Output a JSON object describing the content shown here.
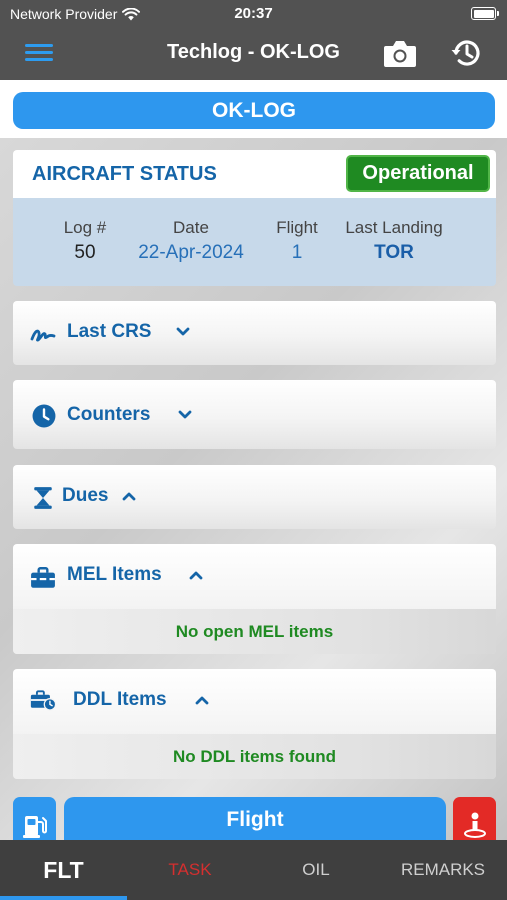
{
  "status_bar": {
    "carrier": "Network Provider",
    "time": "20:37"
  },
  "nav": {
    "title": "Techlog - OK-LOG",
    "icons": [
      "menu-icon",
      "camera-icon",
      "history-icon"
    ]
  },
  "log_button": "OK-LOG",
  "aircraft_status": {
    "title": "AIRCRAFT STATUS",
    "badge": "Operational",
    "columns": [
      {
        "label": "Log #",
        "value": "50"
      },
      {
        "label": "Date",
        "value": "22-Apr-2024"
      },
      {
        "label": "Flight",
        "value": "1"
      },
      {
        "label": "Last Landing",
        "value": "TOR"
      }
    ]
  },
  "sections": [
    {
      "label": "Last CRS",
      "icon": "signature-icon",
      "expanded": false
    },
    {
      "label": "Counters",
      "icon": "clock-icon",
      "expanded": false
    },
    {
      "label": "Dues",
      "icon": "hourglass-icon",
      "expanded": true
    },
    {
      "label": "MEL Items",
      "icon": "toolbox-icon",
      "expanded": true,
      "message": "No open MEL items"
    },
    {
      "label": "DDL Items",
      "icon": "briefcase-clock-icon",
      "expanded": true,
      "message": "No DDL items found"
    }
  ],
  "bottom_actions": {
    "flight_label": "Flight",
    "left_icon": "fuel-pump-icon",
    "right_icon": "person-alert-icon"
  },
  "tabs": [
    {
      "label": "FLT",
      "active": true
    },
    {
      "label": "TASK",
      "active": false
    },
    {
      "label": "OIL",
      "active": false
    },
    {
      "label": "REMARKS",
      "active": false
    }
  ],
  "colors": {
    "accent": "#2e97ee",
    "header": "#525252",
    "operational": "#1f8a22",
    "task_tab": "#d42f2f",
    "label_blue": "#1565a8"
  }
}
